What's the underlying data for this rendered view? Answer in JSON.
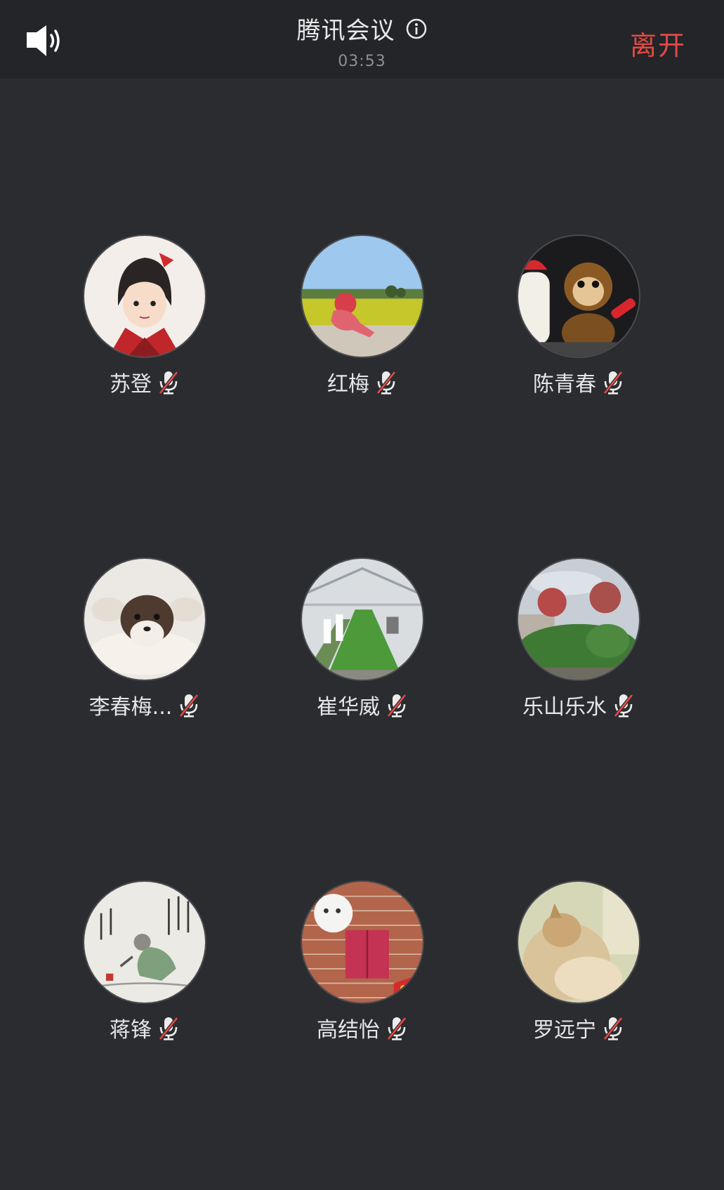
{
  "header": {
    "title": "腾讯会议",
    "timer": "03:53",
    "leave_label": "离开",
    "speaker_icon": "speaker-icon",
    "info_icon": "info-icon"
  },
  "colors": {
    "background": "#2b2c30",
    "topbar": "#242528",
    "leave": "#e44a45",
    "muted_slash": "#e44a45"
  },
  "participants": [
    {
      "name": "苏登",
      "muted": true,
      "avatar": "cartoon-boy-avatar"
    },
    {
      "name": "红梅",
      "muted": true,
      "avatar": "person-in-field-avatar"
    },
    {
      "name": "陈青春",
      "muted": true,
      "avatar": "monkey-toy-avatar"
    },
    {
      "name": "李春梅...",
      "muted": true,
      "avatar": "puppy-avatar"
    },
    {
      "name": "崔华威",
      "muted": true,
      "avatar": "greenhouse-avatar"
    },
    {
      "name": "乐山乐水",
      "muted": true,
      "avatar": "trees-avatar"
    },
    {
      "name": "蒋锋",
      "muted": true,
      "avatar": "ink-painting-avatar"
    },
    {
      "name": "高结怡",
      "muted": true,
      "avatar": "brick-wall-avatar"
    },
    {
      "name": "罗远宁",
      "muted": true,
      "avatar": "cat-avatar"
    }
  ]
}
